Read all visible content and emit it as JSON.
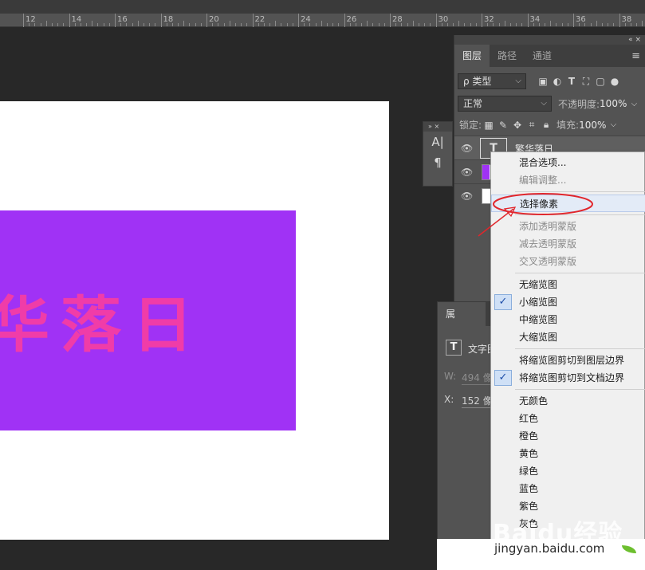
{
  "ruler": {
    "labels": [
      "12",
      "14",
      "16",
      "18",
      "20",
      "22",
      "24",
      "26",
      "28",
      "30",
      "32",
      "34",
      "36",
      "38"
    ]
  },
  "canvas": {
    "text": "华落日",
    "bg_color": "#a032f5",
    "text_color": "#f03ca8"
  },
  "mini_tools": {
    "items": [
      "A|",
      "¶"
    ]
  },
  "layers_panel": {
    "collapse": "«  ×",
    "tabs": [
      "图层",
      "路径",
      "通道"
    ],
    "filter": "ρ 类型",
    "blend_mode": "正常",
    "opacity_label": "不透明度:",
    "opacity": "100%",
    "lock_label": "锁定:",
    "fill_label": "填充:",
    "fill": "100%",
    "layers": [
      {
        "name": "繁华落日",
        "type": "text"
      },
      {
        "name": "",
        "type": "shape"
      },
      {
        "name": "",
        "type": "background"
      }
    ]
  },
  "properties_panel": {
    "tab": "属",
    "type_label": "文字图",
    "w_label": "W:",
    "w_value": "494 像素",
    "x_label": "X:",
    "x_value": "152 像素"
  },
  "context_menu": {
    "items": [
      {
        "label": "混合选项...",
        "enabled": true
      },
      {
        "label": "编辑调整...",
        "enabled": false
      },
      {
        "label": "选择像素",
        "enabled": true,
        "highlighted": true
      },
      {
        "label": "添加透明蒙版",
        "enabled": false
      },
      {
        "label": "减去透明蒙版",
        "enabled": false
      },
      {
        "label": "交叉透明蒙版",
        "enabled": false
      },
      {
        "label": "无缩览图",
        "enabled": true
      },
      {
        "label": "小缩览图",
        "enabled": true,
        "checked": true
      },
      {
        "label": "中缩览图",
        "enabled": true
      },
      {
        "label": "大缩览图",
        "enabled": true
      },
      {
        "label": "将缩览图剪切到图层边界",
        "enabled": true
      },
      {
        "label": "将缩览图剪切到文档边界",
        "enabled": true,
        "checked": true
      },
      {
        "label": "无颜色",
        "enabled": true
      },
      {
        "label": "红色",
        "enabled": true
      },
      {
        "label": "橙色",
        "enabled": true
      },
      {
        "label": "黄色",
        "enabled": true
      },
      {
        "label": "绿色",
        "enabled": true
      },
      {
        "label": "蓝色",
        "enabled": true
      },
      {
        "label": "紫色",
        "enabled": true
      },
      {
        "label": "灰色",
        "enabled": true
      }
    ]
  },
  "watermark": {
    "brand": "Baidu经验",
    "url": "jingyan.baidu.com"
  },
  "colors": {
    "annotation": "#e1262c",
    "menu_highlight": "#e3ebf7"
  }
}
